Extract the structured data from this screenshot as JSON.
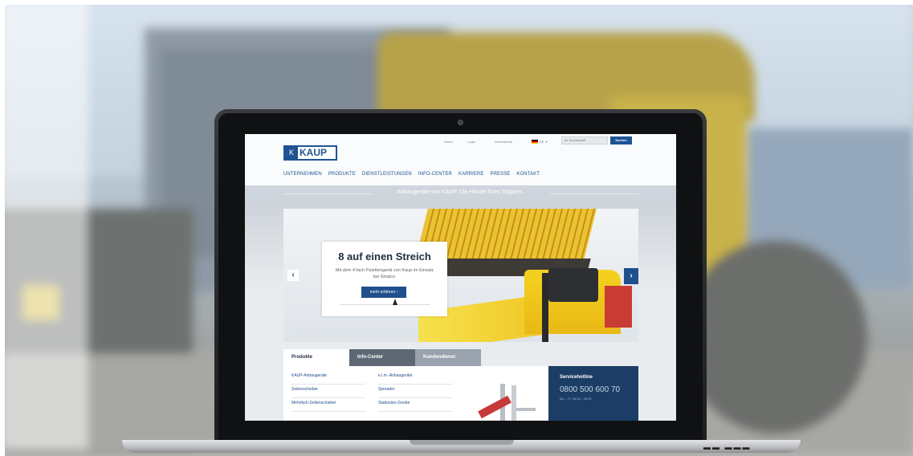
{
  "site": {
    "logo_text": "KAUP",
    "util": {
      "home": "Home",
      "login": "Login",
      "international": "International",
      "language": "DE",
      "search_placeholder": "Ihr Suchbegriff",
      "search_button": "Suchen"
    },
    "nav": [
      "UNTERNEHMEN",
      "PRODUKTE",
      "DIENSTLEISTUNGEN",
      "INFO-CENTER",
      "KARRIERE",
      "PRESSE",
      "KONTAKT"
    ],
    "tagline": "Anbaugeräte von KAUP. Die Hände Ihres Staplers.",
    "hero": {
      "title": "8 auf einen Streich",
      "text": "Mit dem 4-fach Palettengerät von Kaup im Einsatz bei Sinalco.",
      "button": "mehr erfahren ›",
      "prev": "‹",
      "next": "›"
    },
    "tabs": [
      "Produkte",
      "Info-Center",
      "Kundendienst"
    ],
    "products_col1": [
      "KAUP-Anbaugeräte",
      "Seitenschieber",
      "Mehrfach-Seitenschieber"
    ],
    "products_col2": [
      "e.l.m.-Anbaugeräte",
      "Spreader",
      "Stationäre Geräte"
    ],
    "hotline": {
      "title": "Servicehotline",
      "phone": "0800 500 600 70",
      "hours": "Mo. - Fr. 08.00 - 18.00"
    }
  },
  "colors": {
    "brand_blue": "#1f5494",
    "hotline_bg": "#1b3d66"
  }
}
